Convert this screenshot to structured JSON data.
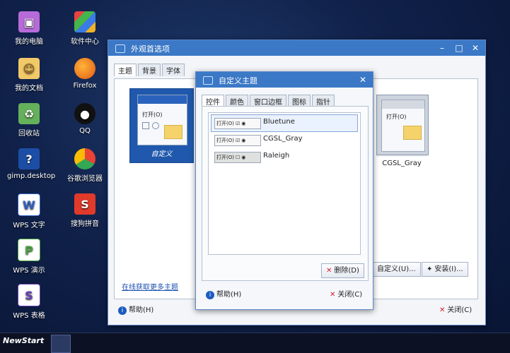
{
  "desktop": {
    "icons": [
      {
        "label": "我的电脑",
        "icon": "computer-icon"
      },
      {
        "label": "软件中心",
        "icon": "software-center-icon"
      },
      {
        "label": "我的文档",
        "icon": "documents-icon"
      },
      {
        "label": "Firefox",
        "icon": "firefox-icon"
      },
      {
        "label": "回收站",
        "icon": "recycle-bin-icon"
      },
      {
        "label": "QQ",
        "icon": "qq-icon"
      },
      {
        "label": "gimp.desktop",
        "icon": "gimp-icon"
      },
      {
        "label": "谷歌浏览器",
        "icon": "chrome-icon"
      },
      {
        "label": "WPS 文字",
        "icon": "wps-writer-icon"
      },
      {
        "label": "搜狗拼音",
        "icon": "sogou-icon"
      },
      {
        "label": "WPS 演示",
        "icon": "wps-presentation-icon"
      },
      {
        "label": "WPS 表格",
        "icon": "wps-spreadsheet-icon"
      }
    ]
  },
  "main_window": {
    "title": "外观首选项",
    "tabs": [
      "主题",
      "背景",
      "字体"
    ],
    "themes": [
      {
        "label": "自定义"
      },
      {
        "label": "CGSL_Gray"
      }
    ],
    "preview_text": "打开(O)",
    "link": "在线获取更多主题",
    "buttons": {
      "customize": "自定义(U)...",
      "install": "安装(I)...",
      "help": "帮助(H)",
      "close": "关闭(C)"
    }
  },
  "dialog": {
    "title": "自定义主题",
    "tabs": [
      "控件",
      "颜色",
      "窗口边框",
      "图标",
      "指针"
    ],
    "items": [
      {
        "name": "Bluetune",
        "selected": true
      },
      {
        "name": "CGSL_Gray",
        "selected": false
      },
      {
        "name": "Raleigh",
        "selected": false
      }
    ],
    "preview_label": "打开(O)",
    "buttons": {
      "delete": "删除(D)",
      "help": "帮助(H)",
      "close": "关闭(C)"
    }
  },
  "taskbar": {
    "start_label": "NewStart"
  }
}
